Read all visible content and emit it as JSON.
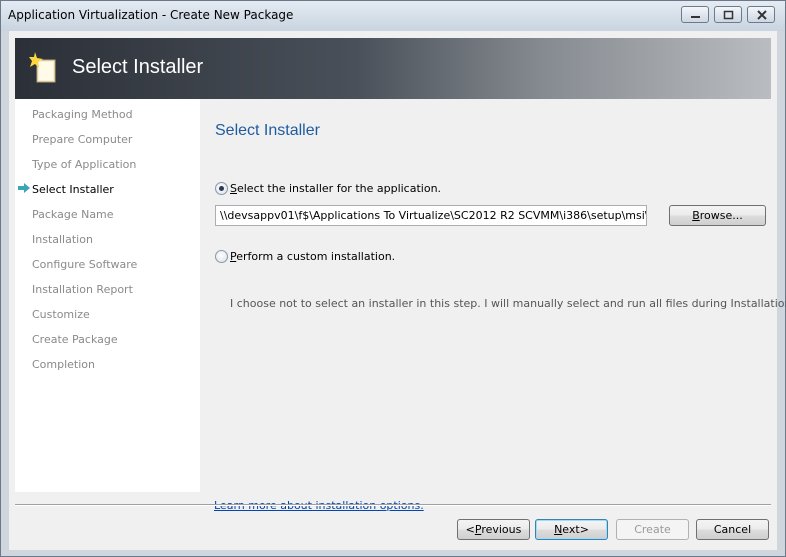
{
  "window": {
    "title": "Application Virtualization - Create New Package"
  },
  "banner": {
    "title": "Select Installer",
    "icon": "package-wand-icon"
  },
  "nav": {
    "items": [
      {
        "label": "Packaging Method",
        "active": false
      },
      {
        "label": "Prepare Computer",
        "active": false
      },
      {
        "label": "Type of Application",
        "active": false
      },
      {
        "label": "Select Installer",
        "active": true
      },
      {
        "label": "Package Name",
        "active": false
      },
      {
        "label": "Installation",
        "active": false
      },
      {
        "label": "Configure Software",
        "active": false
      },
      {
        "label": "Installation Report",
        "active": false
      },
      {
        "label": "Customize",
        "active": false
      },
      {
        "label": "Create Package",
        "active": false
      },
      {
        "label": "Completion",
        "active": false
      }
    ]
  },
  "main": {
    "heading": "Select Installer",
    "option_select": {
      "accel": "S",
      "label_rest": "elect the installer for the application.",
      "checked": true
    },
    "installer_path": "\\\\devsappv01\\f$\\Applications To Virtualize\\SC2012 R2 SCVMM\\i386\\setup\\msi\\Client\\AdminConsole.msi",
    "browse_button": {
      "accel": "B",
      "rest": "rowse..."
    },
    "option_custom": {
      "accel": "P",
      "label_rest": "erform a custom installation.",
      "checked": false,
      "description": "I choose not to select an installer in this step.  I will manually select and run all files during Installation."
    },
    "learn_more": "Learn more about installation options."
  },
  "footer": {
    "previous": {
      "prefix": "<",
      "accel": "P",
      "rest": "revious"
    },
    "next": {
      "accel": "N",
      "rest": "ext",
      "suffix": ">"
    },
    "create": "Create",
    "cancel": "Cancel"
  }
}
